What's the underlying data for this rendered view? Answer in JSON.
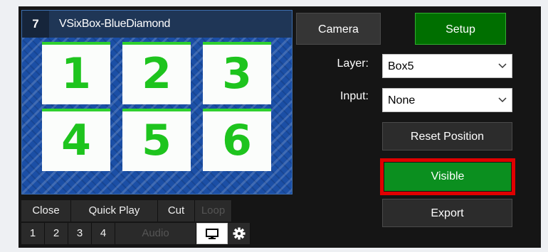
{
  "input": {
    "number": "7",
    "name": "VSixBox-BlueDiamond",
    "tiles": [
      "1",
      "2",
      "3",
      "4",
      "5",
      "6"
    ]
  },
  "controls": {
    "row1": [
      "Close",
      "Quick Play",
      "Cut",
      "Loop"
    ],
    "row2": [
      "1",
      "2",
      "3",
      "4",
      "Audio"
    ],
    "monitor_icon": "monitor-icon",
    "settings_icon": "gear-icon"
  },
  "right": {
    "camera_label": "Camera",
    "setup_label": "Setup",
    "layer_label": "Layer:",
    "layer_value": "Box5",
    "input_label": "Input:",
    "input_value": "None",
    "reset_label": "Reset Position",
    "visible_label": "Visible",
    "export_label": "Export"
  },
  "colors": {
    "setup_green": "#006f00",
    "visible_green": "#0b8f1f",
    "highlight_red": "#e00000",
    "tile_green": "#1ec41e"
  }
}
